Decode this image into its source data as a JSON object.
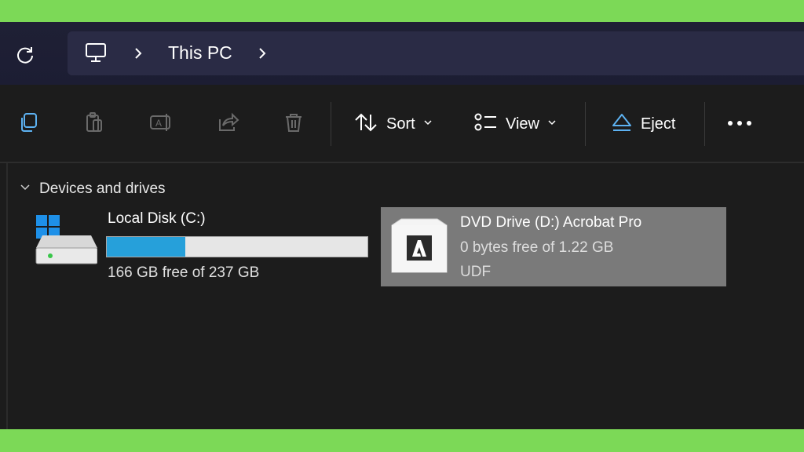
{
  "address_bar": {
    "refresh_icon": "refresh-icon",
    "pc_icon": "computer-monitor-icon",
    "breadcrumb": [
      "This PC"
    ]
  },
  "toolbar": {
    "copy_icon": "copy-icon",
    "paste_icon": "paste-icon",
    "rename_icon": "rename-icon",
    "share_icon": "share-icon",
    "delete_icon": "delete-icon",
    "sort_label": "Sort",
    "view_label": "View",
    "eject_label": "Eject",
    "more_icon": "more-icon"
  },
  "content": {
    "group_label": "Devices and drives",
    "drives": [
      {
        "name": "Local Disk (C:)",
        "free_text": "166 GB free of 237 GB",
        "used_fraction": 0.3
      },
      {
        "name": "DVD Drive (D:) Acrobat Pro",
        "free_text": "0 bytes free of 1.22 GB",
        "filesystem": "UDF",
        "selected": true
      }
    ]
  },
  "colors": {
    "frame_border": "#7cd957",
    "background": "#1c1c1c",
    "address_background": "#1f2035",
    "progress_fill": "#26a0da",
    "selection": "#7a7a7a"
  }
}
